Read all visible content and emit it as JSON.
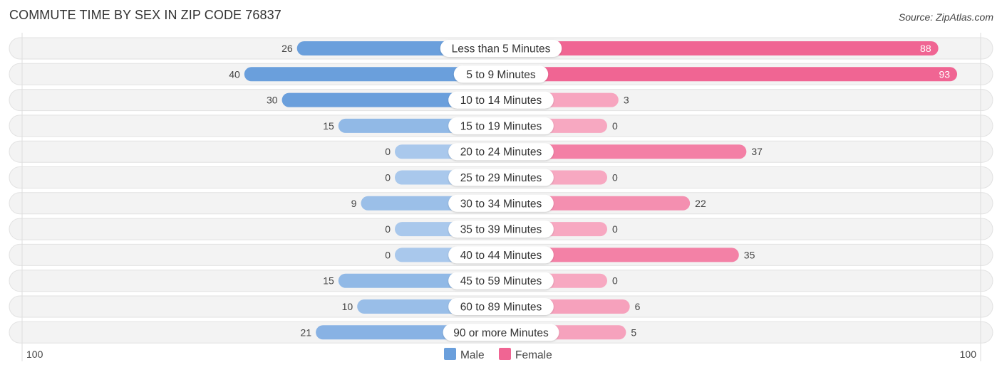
{
  "header": {
    "title": "COMMUTE TIME BY SEX IN ZIP CODE 76837",
    "source": "Source: ZipAtlas.com"
  },
  "colors": {
    "male_strong": "#6a9fdc",
    "male_light": "#a9c8ec",
    "female_strong": "#f06593",
    "female_light": "#f7a8c1",
    "row_bg": "#f3f3f3"
  },
  "chart_data": {
    "type": "bar",
    "orientation": "horizontal-diverging",
    "title": "COMMUTE TIME BY SEX IN ZIP CODE 76837",
    "categories": [
      "Less than 5 Minutes",
      "5 to 9 Minutes",
      "10 to 14 Minutes",
      "15 to 19 Minutes",
      "20 to 24 Minutes",
      "25 to 29 Minutes",
      "30 to 34 Minutes",
      "35 to 39 Minutes",
      "40 to 44 Minutes",
      "45 to 59 Minutes",
      "60 to 89 Minutes",
      "90 or more Minutes"
    ],
    "series": [
      {
        "name": "Male",
        "side": "left",
        "values": [
          26,
          40,
          30,
          15,
          0,
          0,
          9,
          0,
          0,
          15,
          10,
          21
        ]
      },
      {
        "name": "Female",
        "side": "right",
        "values": [
          88,
          93,
          3,
          0,
          37,
          0,
          22,
          0,
          35,
          0,
          6,
          5
        ]
      }
    ],
    "axis": {
      "left_label": "100",
      "right_label": "100",
      "max": 100
    },
    "legend": {
      "position": "bottom-center",
      "entries": [
        "Male",
        "Female"
      ]
    }
  }
}
